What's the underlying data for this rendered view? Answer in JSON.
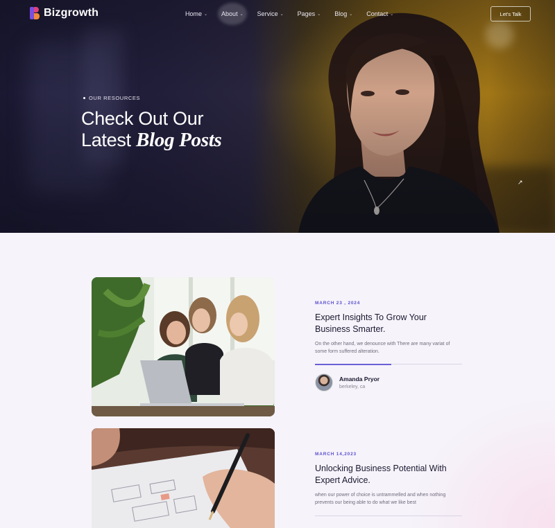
{
  "nav": {
    "brand": "Bizgrowth",
    "items": [
      {
        "label": "Home"
      },
      {
        "label": "About"
      },
      {
        "label": "Service"
      },
      {
        "label": "Pages"
      },
      {
        "label": "Blog"
      },
      {
        "label": "Contact"
      }
    ],
    "cta_label": "Let's Talk"
  },
  "hero": {
    "eyebrow": "OUR RESOURCES",
    "title_line1": "Check Out Our",
    "title_line2_plain": "Latest ",
    "title_line2_accent": "Blog Posts"
  },
  "posts": [
    {
      "date": "MARCH 23 , 2024",
      "title": "Expert Insights To Grow Your Business Smarter.",
      "excerpt": "On the other hand, we denounce with There are many variat of some form suffered alteration.",
      "author_name": "Amanda Pryor",
      "author_location": "berkeley, ca",
      "progress": 0.52
    },
    {
      "date": "MARCH 14,2023",
      "title": "Unlocking Business Potential With Expert Advice.",
      "excerpt": "when our power of choice is untrammelled and when nothing prevents our being able to do what we like best"
    }
  ],
  "colors": {
    "accent": "#5a4fcf",
    "logo_pink": "#e0407e",
    "logo_purple": "#7a4fe0",
    "logo_orange": "#f08a3c"
  },
  "icons": [
    "logo-mark-icon",
    "chevron-down-icon",
    "arrow-up-right-icon"
  ]
}
